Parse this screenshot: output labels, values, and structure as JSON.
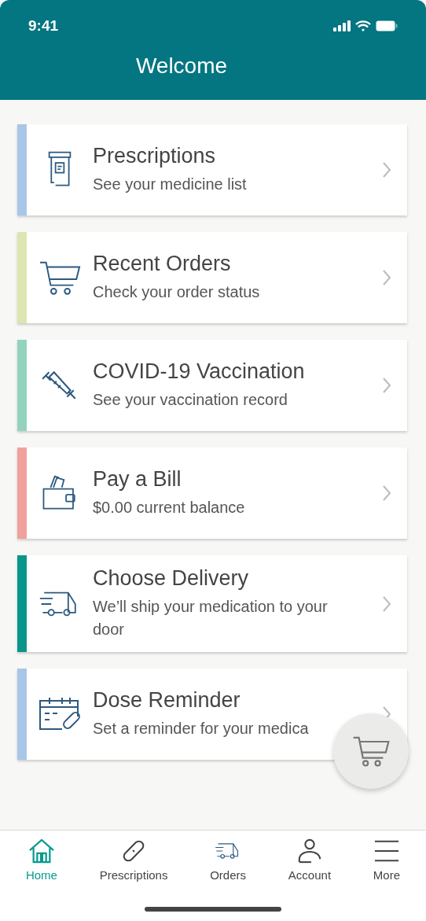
{
  "status_bar": {
    "time": "9:41"
  },
  "header": {
    "title": "Welcome"
  },
  "cards": [
    {
      "title": "Prescriptions",
      "subtitle": "See your medicine list",
      "color": "#a9c6e8"
    },
    {
      "title": "Recent Orders",
      "subtitle": "Check your order status",
      "color": "#dde6b0"
    },
    {
      "title": "COVID-19 Vaccination",
      "subtitle": "See your vaccination record",
      "color": "#93d3bd"
    },
    {
      "title": "Pay a Bill",
      "subtitle": "$0.00 current balance",
      "color": "#f0a19c"
    },
    {
      "title": "Choose Delivery",
      "subtitle": "We’ll ship your medication to your door",
      "color": "#08968a"
    },
    {
      "title": "Dose Reminder",
      "subtitle": "Set a reminder for your medica",
      "color": "#a9c6e8"
    }
  ],
  "tabs": [
    {
      "label": "Home",
      "selected": true
    },
    {
      "label": "Prescriptions",
      "selected": false
    },
    {
      "label": "Orders",
      "selected": false
    },
    {
      "label": "Account",
      "selected": false
    },
    {
      "label": "More",
      "selected": false
    }
  ]
}
